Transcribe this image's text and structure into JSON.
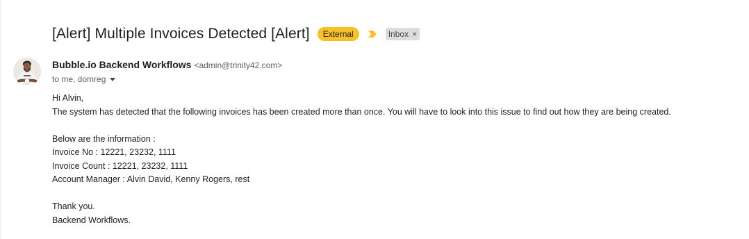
{
  "email": {
    "subject": "[Alert] Multiple Invoices Detected [Alert]",
    "badge_external": "External",
    "label_inbox": "Inbox",
    "label_close": "×",
    "sender_name": "Bubble.io Backend Workflows",
    "sender_email": "<admin@trinity42.com>",
    "recipients": "to me, domreg",
    "body": {
      "greeting": "Hi Alvin,",
      "line1": "The system has detected that the following invoices has been created more than once. You will have to look into this issue to find out how they are being created.",
      "info_header": "Below are the information :",
      "invoice_no": "Invoice No : 12221, 23232, 1111",
      "invoice_count": "Invoice Count : 12221, 23232, 1111",
      "account_manager": "Account Manager : Alvin David, Kenny Rogers, rest",
      "thanks": "Thank you.",
      "signature": "Backend Workflows."
    }
  },
  "icons": {
    "importance": "importance-marker-icon",
    "avatar": "sender-avatar",
    "recipients_caret": "chevron-down-icon"
  },
  "colors": {
    "external_badge": "#f6c026",
    "importance_marker": "#f6c026",
    "inbox_label_bg": "#dddddd"
  }
}
